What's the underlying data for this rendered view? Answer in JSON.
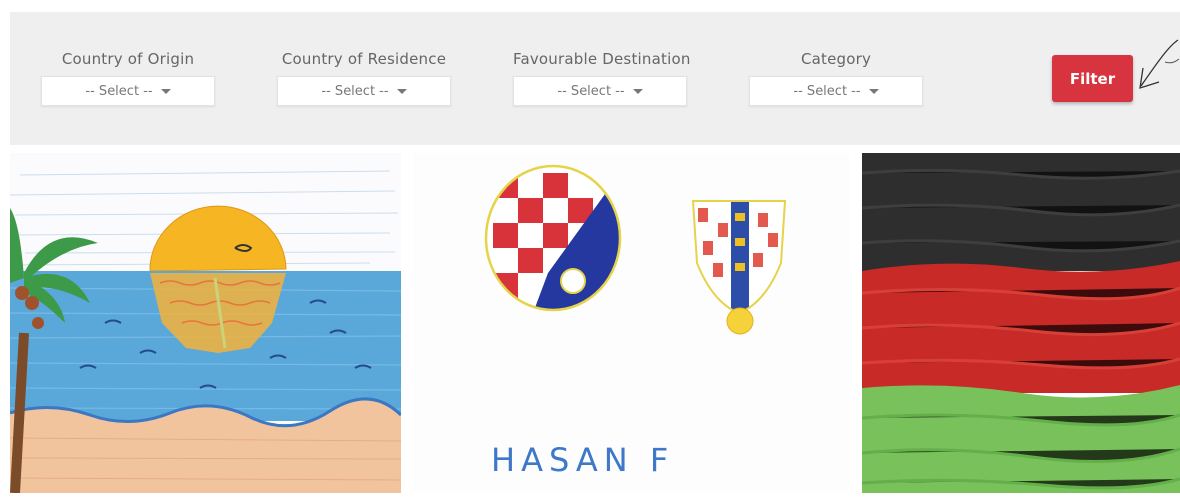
{
  "filters": [
    {
      "label": "Country of Origin",
      "value": "-- Select --"
    },
    {
      "label": "Country of Residence",
      "value": "-- Select --"
    },
    {
      "label": "Favourable Destination",
      "value": "-- Select --"
    },
    {
      "label": "Category",
      "value": "-- Select --"
    }
  ],
  "filter_button": {
    "label": "Filter",
    "color": "#d8343f"
  },
  "gallery": [
    {
      "name": "beach-sunset-drawing"
    },
    {
      "name": "croatia-emblems-drawing",
      "signature": "HASAN F"
    },
    {
      "name": "flag-painting"
    }
  ]
}
